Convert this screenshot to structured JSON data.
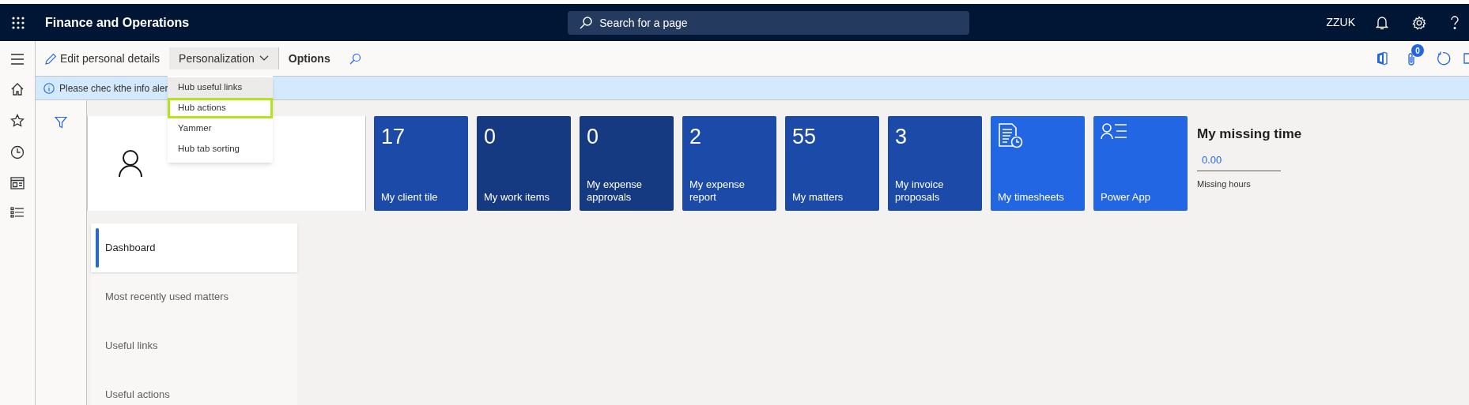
{
  "app_title": "Finance and Operations",
  "search": {
    "placeholder": "Search for a page"
  },
  "header_right": {
    "company": "ZZUK"
  },
  "toolbar": {
    "items": [
      {
        "kind": "edit",
        "label": "Edit personal details"
      },
      {
        "kind": "dropdown",
        "label": "Personalization",
        "expanded": true
      },
      {
        "kind": "bold",
        "label": "Options"
      },
      {
        "kind": "search"
      }
    ],
    "attachments_badge": "0"
  },
  "info_bar": {
    "text": "Please chec kthe info aler"
  },
  "dropdown": {
    "items": [
      {
        "label": "Hub useful links",
        "hovered": true,
        "selected": false
      },
      {
        "label": "Hub actions",
        "hovered": false,
        "selected": true
      },
      {
        "label": "Yammer",
        "hovered": false,
        "selected": false
      },
      {
        "label": "Hub tab sorting",
        "hovered": false,
        "selected": false
      }
    ]
  },
  "tiles": [
    {
      "kind": "count",
      "value": "17",
      "label": "My client tile",
      "color": "#1b4aa8"
    },
    {
      "kind": "count",
      "value": "0",
      "label": "My work items",
      "color": "#163a82"
    },
    {
      "kind": "count",
      "value": "0",
      "label": "My expense approvals",
      "color": "#163a82"
    },
    {
      "kind": "count",
      "value": "2",
      "label": "My expense report",
      "color": "#1b4aa8"
    },
    {
      "kind": "count",
      "value": "55",
      "label": "My matters",
      "color": "#1b4aa8"
    },
    {
      "kind": "count",
      "value": "3",
      "label": "My invoice proposals",
      "color": "#1b4aa8"
    },
    {
      "kind": "timesheet",
      "label": "My timesheets",
      "color": "#2266e3"
    },
    {
      "kind": "people",
      "label": "Power App",
      "color": "#2266e3"
    }
  ],
  "missing_time": {
    "title": "My missing time",
    "value": "0.00",
    "label": "Missing hours"
  },
  "tabs": [
    {
      "label": "Dashboard",
      "selected": true
    },
    {
      "label": "Most recently used matters",
      "selected": false
    },
    {
      "label": "Useful links",
      "selected": false
    },
    {
      "label": "Useful actions",
      "selected": false
    }
  ]
}
